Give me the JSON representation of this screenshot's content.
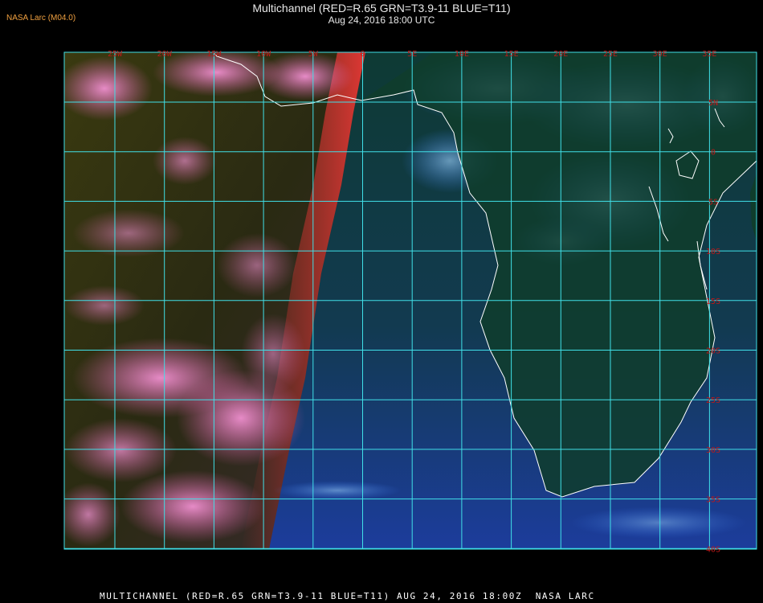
{
  "header": {
    "producer": "NASA Larc (M04.0)",
    "title": "Multichannel (RED=R.65 GRN=T3.9-11 BLUE=T11)",
    "datetime": "Aug 24, 2016 18:00 UTC"
  },
  "footer": {
    "caption": "MULTICHANNEL (RED=R.65 GRN=T3.9-11 BLUE=T11) AUG 24, 2016 18:00Z  NASA LARC"
  },
  "map": {
    "longitude_labels": [
      "25W",
      "20W",
      "15W",
      "10W",
      "5W",
      "0",
      "5E",
      "10E",
      "15E",
      "20E",
      "25E",
      "30E",
      "35E"
    ],
    "latitude_labels": [
      "5N",
      "0",
      "5S",
      "10S",
      "15S",
      "20S",
      "25S",
      "30S",
      "35S",
      "40S"
    ],
    "colors": {
      "gridline": "#40e0e8",
      "coastline": "#ffffff",
      "grid_label": "#c01818",
      "ocean_dark": "#0c2a20",
      "ocean_blue": "#1a3c9a",
      "land": "#0e3a26",
      "cloud_pink": "#e870b8",
      "cloud_blue": "#5aa0ff",
      "terminator_red": "#e03030"
    }
  }
}
